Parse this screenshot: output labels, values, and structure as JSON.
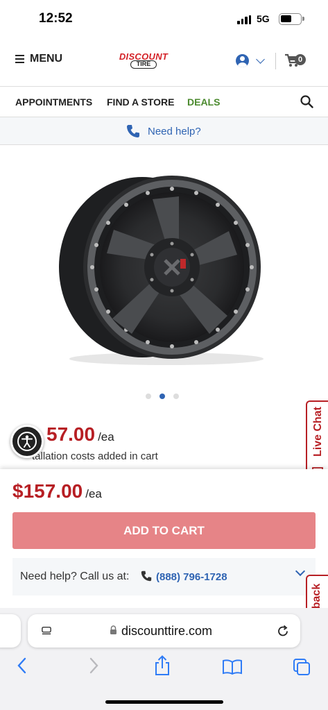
{
  "status_bar": {
    "time": "12:52",
    "network": "5G"
  },
  "header": {
    "menu_label": "MENU",
    "logo_top": "DISCOUNT",
    "logo_bottom": "TIRE",
    "cart_count": "0"
  },
  "nav": {
    "items": [
      "APPOINTMENTS",
      "FIND A STORE",
      "DEALS"
    ]
  },
  "help_bar": {
    "label": "Need help?"
  },
  "carousel": {
    "total": 3,
    "active_index": 1
  },
  "product": {
    "price_partial": "57.00",
    "per_unit": "/ea",
    "install_note_partial": "tallation costs added in cart"
  },
  "sticky": {
    "price": "$157.00",
    "per_unit": "/ea",
    "add_to_cart": "ADD TO CART",
    "call_label": "Need help? Call us at:",
    "phone": "(888) 796-1728"
  },
  "side_tabs": {
    "live_chat": "Live Chat",
    "feedback_partial": "back"
  },
  "browser": {
    "url": "discounttire.com"
  },
  "colors": {
    "brand_red": "#b71f24",
    "link_blue": "#2f64b3",
    "deals_green": "#4b8a2e",
    "button_disabled": "#e68487"
  }
}
